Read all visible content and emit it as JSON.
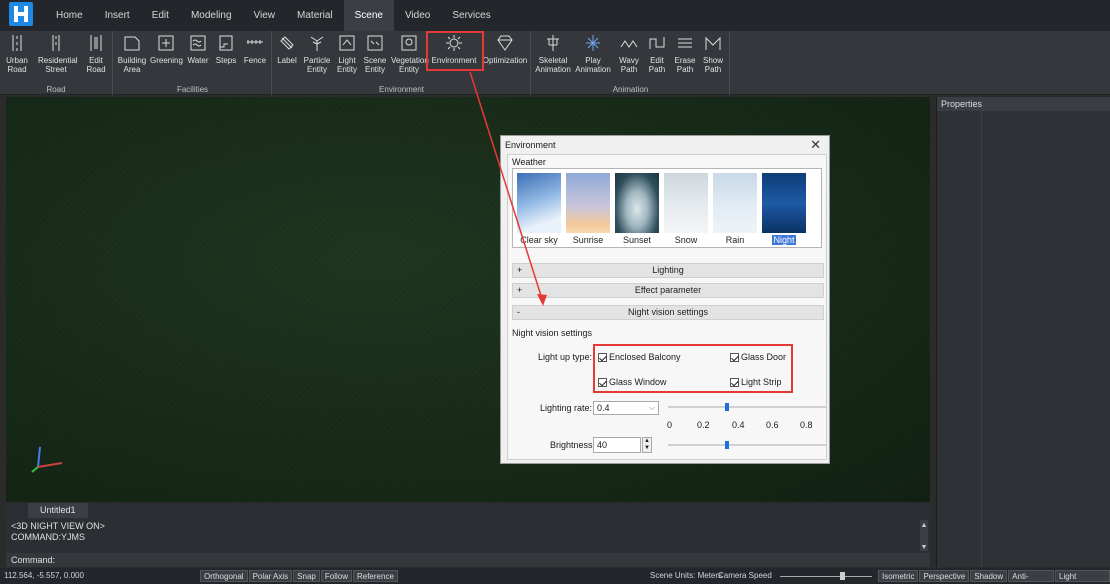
{
  "menubar": {
    "tabs": [
      "Home",
      "Insert",
      "Edit",
      "Modeling",
      "View",
      "Material",
      "Scene",
      "Video",
      "Services"
    ],
    "active_tab": "Scene"
  },
  "ribbon": {
    "groups": [
      {
        "label": "Road",
        "buttons": [
          "Urban Road",
          "Residential Street",
          "Edit Road"
        ]
      },
      {
        "label": "Facilities",
        "buttons": [
          "Building Area",
          "Greening",
          "Water",
          "Steps",
          "Fence"
        ]
      },
      {
        "label": "Environment",
        "buttons": [
          "Label",
          "Particle Entity",
          "Light Entity",
          "Scene Entity",
          "Vegetation Entity",
          "Environment",
          "Optimization"
        ]
      },
      {
        "label": "Animation",
        "buttons": [
          "Skeletal Animation",
          "Play Animation",
          "Wavy Path",
          "Edit Path",
          "Erase Path",
          "Show Path"
        ]
      }
    ]
  },
  "props_panel": {
    "title": "Properties"
  },
  "doc_tab": {
    "label": "Untitled1"
  },
  "command": {
    "lines": [
      "<3D NIGHT VIEW ON>",
      "COMMAND:YJMS"
    ],
    "prompt": "Command:"
  },
  "statusbar": {
    "coords": "112.564, -5.557, 0.000",
    "snap_buttons": [
      "Orthogonal",
      "Polar Axis",
      "Snap",
      "Follow",
      "Reference"
    ],
    "units": "Scene Units: Meters",
    "camera_speed_label": "Camera Speed",
    "view_buttons": [
      "Isometric",
      "Perspective",
      "Shadow",
      "Anti-Aliasing",
      "Light Projection"
    ]
  },
  "dialog": {
    "title": "Environment",
    "weather_label": "Weather",
    "weather_options": [
      "Clear sky",
      "Sunrise",
      "Sunset",
      "Snow",
      "Rain",
      "Night"
    ],
    "selected_weather": "Night",
    "sections": [
      {
        "sign": "+",
        "label": "Lighting"
      },
      {
        "sign": "+",
        "label": "Effect parameter"
      },
      {
        "sign": "-",
        "label": "Night vision settings"
      }
    ],
    "night_vision": {
      "title": "Night vision settings",
      "light_up_label": "Light up type:",
      "checkboxes": [
        "Enclosed Balcony",
        "Glass Door",
        "Glass Window",
        "Light Strip"
      ],
      "lighting_rate_label": "Lighting rate:",
      "lighting_rate_value": "0.4",
      "lighting_rate_fraction": 0.4,
      "ticks": [
        "0",
        "0.2",
        "0.4",
        "0.6",
        "0.8"
      ],
      "brightness_label": "Brightness:",
      "brightness_value": "40",
      "brightness_fraction": 0.4
    }
  },
  "colors": {
    "highlight": "#e53935",
    "accent": "#1e6fd9",
    "selection": "#3c78d8"
  }
}
